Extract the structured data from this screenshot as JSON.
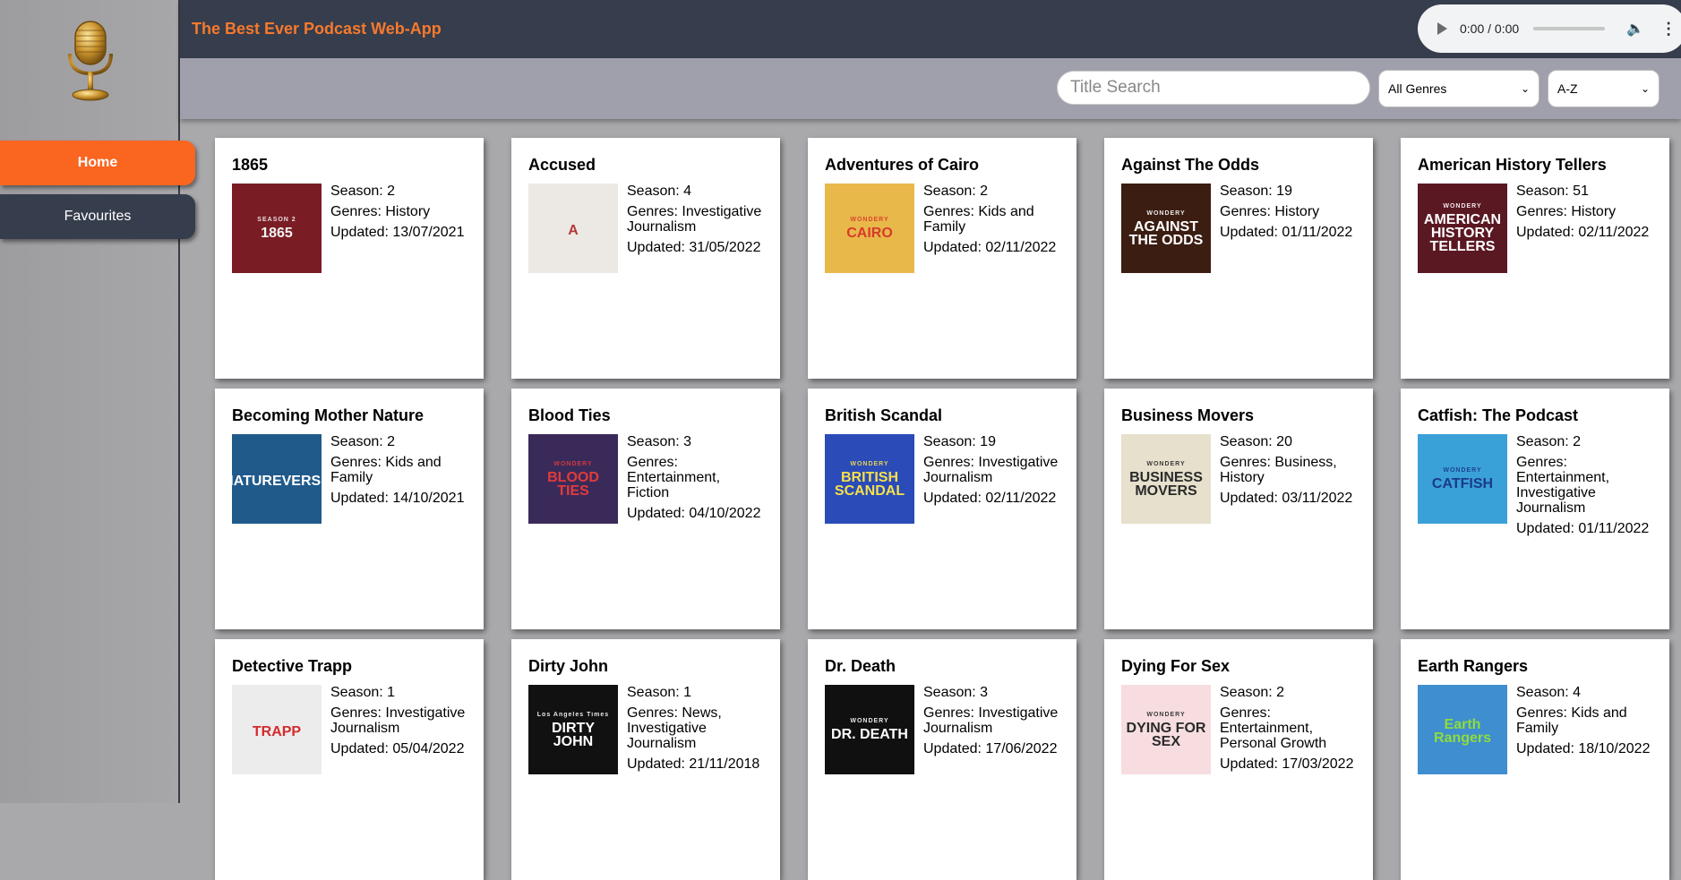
{
  "header": {
    "title": "The Best Ever Podcast Web-App"
  },
  "audio": {
    "time": "0:00 / 0:00"
  },
  "sidebar": {
    "items": [
      {
        "label": "Home"
      },
      {
        "label": "Favourites"
      }
    ]
  },
  "toolbar": {
    "search_placeholder": "Title Search",
    "genre_selected": "All Genres",
    "sort_selected": "A-Z"
  },
  "labels": {
    "season": "Season:",
    "genres": "Genres:",
    "updated": "Updated:"
  },
  "podcasts": [
    {
      "title": "1865",
      "season": "2",
      "genres": "History",
      "updated": "13/07/2021",
      "cover_text": "1865",
      "cover_sub": "SEASON 2",
      "cover_bg": "#7a1c24",
      "cover_fg": "#f3f3f3"
    },
    {
      "title": "Accused",
      "season": "4",
      "genres": "Investigative Journalism",
      "updated": "31/05/2022",
      "cover_text": "A",
      "cover_sub": "",
      "cover_bg": "#ece9e4",
      "cover_fg": "#b23a3a"
    },
    {
      "title": "Adventures of Cairo",
      "season": "2",
      "genres": "Kids and Family",
      "updated": "02/11/2022",
      "cover_text": "CAIRO",
      "cover_sub": "WONDERY",
      "cover_bg": "#e9b84a",
      "cover_fg": "#d63b2b"
    },
    {
      "title": "Against The Odds",
      "season": "19",
      "genres": "History",
      "updated": "01/11/2022",
      "cover_text": "AGAINST THE ODDS",
      "cover_sub": "WONDERY",
      "cover_bg": "#3b1d12",
      "cover_fg": "#ffffff"
    },
    {
      "title": "American History Tellers",
      "season": "51",
      "genres": "History",
      "updated": "02/11/2022",
      "cover_text": "AMERICAN HISTORY TELLERS",
      "cover_sub": "WONDERY",
      "cover_bg": "#5a1822",
      "cover_fg": "#ffffff"
    },
    {
      "title": "Becoming Mother Nature",
      "season": "2",
      "genres": "Kids and Family",
      "updated": "14/10/2021",
      "cover_text": "NATUREVERSE",
      "cover_sub": "",
      "cover_bg": "#1f5a8a",
      "cover_fg": "#ffffff"
    },
    {
      "title": "Blood Ties",
      "season": "3",
      "genres": "Entertainment, Fiction",
      "updated": "04/10/2022",
      "cover_text": "BLOOD TIES",
      "cover_sub": "WONDERY",
      "cover_bg": "#3a2a5a",
      "cover_fg": "#e23b3b"
    },
    {
      "title": "British Scandal",
      "season": "19",
      "genres": "Investigative Journalism",
      "updated": "02/11/2022",
      "cover_text": "BRITISH SCANDAL",
      "cover_sub": "WONDERY",
      "cover_bg": "#2a4bb8",
      "cover_fg": "#f5e04b"
    },
    {
      "title": "Business Movers",
      "season": "20",
      "genres": "Business, History",
      "updated": "03/11/2022",
      "cover_text": "BUSINESS MOVERS",
      "cover_sub": "WONDERY",
      "cover_bg": "#e6e0cc",
      "cover_fg": "#2a2a2a"
    },
    {
      "title": "Catfish: The Podcast",
      "season": "2",
      "genres": "Entertainment, Investigative Journalism",
      "updated": "01/11/2022",
      "cover_text": "CATFISH",
      "cover_sub": "WONDERY",
      "cover_bg": "#3aa0d8",
      "cover_fg": "#1a3a8a"
    },
    {
      "title": "Detective Trapp",
      "season": "1",
      "genres": "Investigative Journalism",
      "updated": "05/04/2022",
      "cover_text": "TRAPP",
      "cover_sub": "",
      "cover_bg": "#ececec",
      "cover_fg": "#d42b2b"
    },
    {
      "title": "Dirty John",
      "season": "1",
      "genres": "News, Investigative Journalism",
      "updated": "21/11/2018",
      "cover_text": "DIRTY JOHN",
      "cover_sub": "Los Angeles Times",
      "cover_bg": "#111111",
      "cover_fg": "#ffffff"
    },
    {
      "title": "Dr. Death",
      "season": "3",
      "genres": "Investigative Journalism",
      "updated": "17/06/2022",
      "cover_text": "DR. DEATH",
      "cover_sub": "WONDERY",
      "cover_bg": "#101010",
      "cover_fg": "#ffffff"
    },
    {
      "title": "Dying For Sex",
      "season": "2",
      "genres": "Entertainment, Personal Growth",
      "updated": "17/03/2022",
      "cover_text": "DYING FOR SEX",
      "cover_sub": "WONDERY",
      "cover_bg": "#f7dde0",
      "cover_fg": "#2a2a2a"
    },
    {
      "title": "Earth Rangers",
      "season": "4",
      "genres": "Kids and Family",
      "updated": "18/10/2022",
      "cover_text": "Earth Rangers",
      "cover_sub": "",
      "cover_bg": "#3f8ed0",
      "cover_fg": "#8fdc3a"
    }
  ]
}
